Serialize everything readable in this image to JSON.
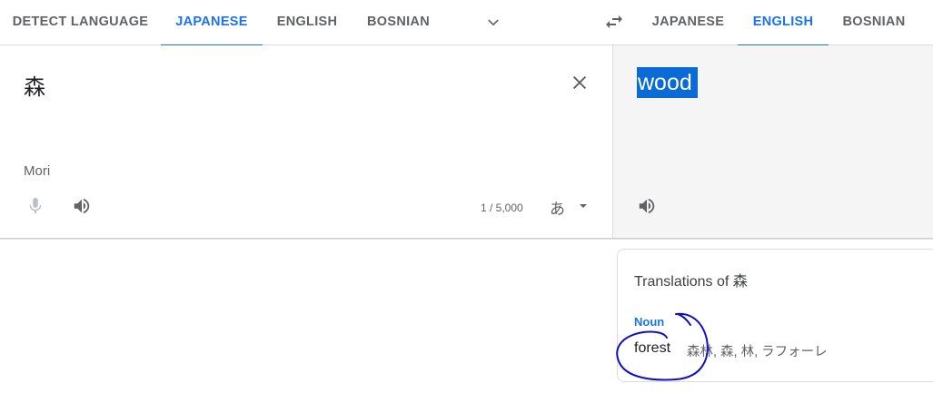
{
  "source_tabs": [
    "DETECT LANGUAGE",
    "JAPANESE",
    "ENGLISH",
    "BOSNIAN"
  ],
  "target_tabs": [
    "JAPANESE",
    "ENGLISH",
    "BOSNIAN"
  ],
  "source": {
    "text": "森",
    "transliteration": "Mori",
    "char_count": "1 / 5,000",
    "input_tool": "あ"
  },
  "target": {
    "text": "wood"
  },
  "dictionary": {
    "title": "Translations of 森",
    "part_of_speech": "Noun",
    "term": "forest",
    "reverse_translations": "森林, 森, 林, ラフォーレ"
  },
  "icons": [
    "more-languages-chevron-icon",
    "swap-languages-icon",
    "clear-text-icon",
    "microphone-icon",
    "speaker-icon",
    "input-tools-caret-icon"
  ],
  "colors": {
    "accent": "#1a73e8",
    "selection": "#0a6ad6",
    "annotation_ink": "#1010c8"
  }
}
